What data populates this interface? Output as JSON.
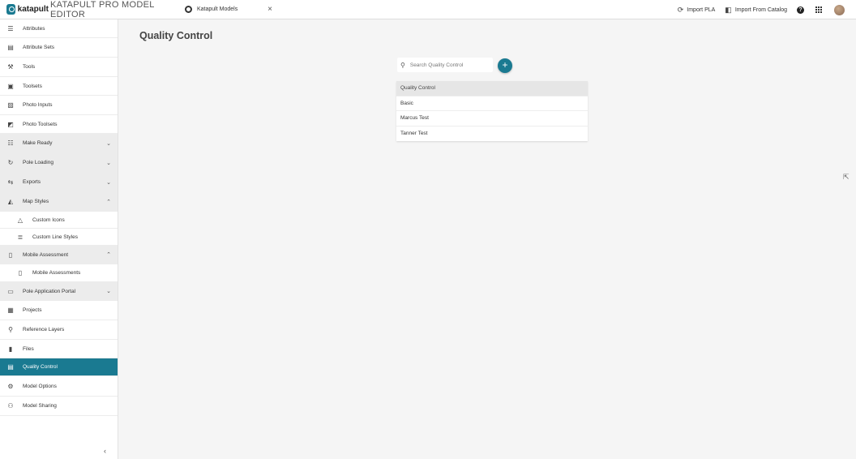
{
  "header": {
    "brand": "katapult",
    "app_title": "KATAPULT PRO MODEL EDITOR",
    "tab_label": "Katapult Models",
    "tab_close": "×",
    "import_pla": "Import PLA",
    "import_catalog": "Import From Catalog",
    "help": "?"
  },
  "sidebar": {
    "items": [
      {
        "label": "Attributes",
        "icon": "list-icon"
      },
      {
        "label": "Attribute Sets",
        "icon": "table-icon"
      },
      {
        "label": "Tools",
        "icon": "tools-icon"
      },
      {
        "label": "Toolsets",
        "icon": "toolbox-icon"
      },
      {
        "label": "Photo Inputs",
        "icon": "photo-icon"
      },
      {
        "label": "Photo Toolsets",
        "icon": "photo-library-icon"
      },
      {
        "label": "Make Ready",
        "icon": "checklist-icon"
      },
      {
        "label": "Pole Loading",
        "icon": "pole-loading-icon"
      },
      {
        "label": "Exports",
        "icon": "export-icon"
      },
      {
        "label": "Map Styles",
        "icon": "map-styles-icon"
      },
      {
        "label": "Custom Icons",
        "icon": "triangle-icon"
      },
      {
        "label": "Custom Line Styles",
        "icon": "line-styles-icon"
      },
      {
        "label": "Mobile Assessment",
        "icon": "mobile-icon"
      },
      {
        "label": "Mobile Assessments",
        "icon": "mobile-icon"
      },
      {
        "label": "Pole Application Portal",
        "icon": "portal-icon"
      },
      {
        "label": "Projects",
        "icon": "projects-icon"
      },
      {
        "label": "Reference Layers",
        "icon": "location-pin-icon"
      },
      {
        "label": "Files",
        "icon": "file-icon"
      },
      {
        "label": "Quality Control",
        "icon": "clipboard-icon"
      },
      {
        "label": "Model Options",
        "icon": "gear-icon"
      },
      {
        "label": "Model Sharing",
        "icon": "share-icon"
      }
    ],
    "collapse_label": "‹"
  },
  "main": {
    "title": "Quality Control",
    "search_placeholder": "Search Quality Control",
    "add_label": "+",
    "list_header": "Quality Control",
    "list_items": [
      "Basic",
      "Marcus Test",
      "Tanner Test"
    ]
  },
  "colors": {
    "accent": "#1a7a91"
  }
}
